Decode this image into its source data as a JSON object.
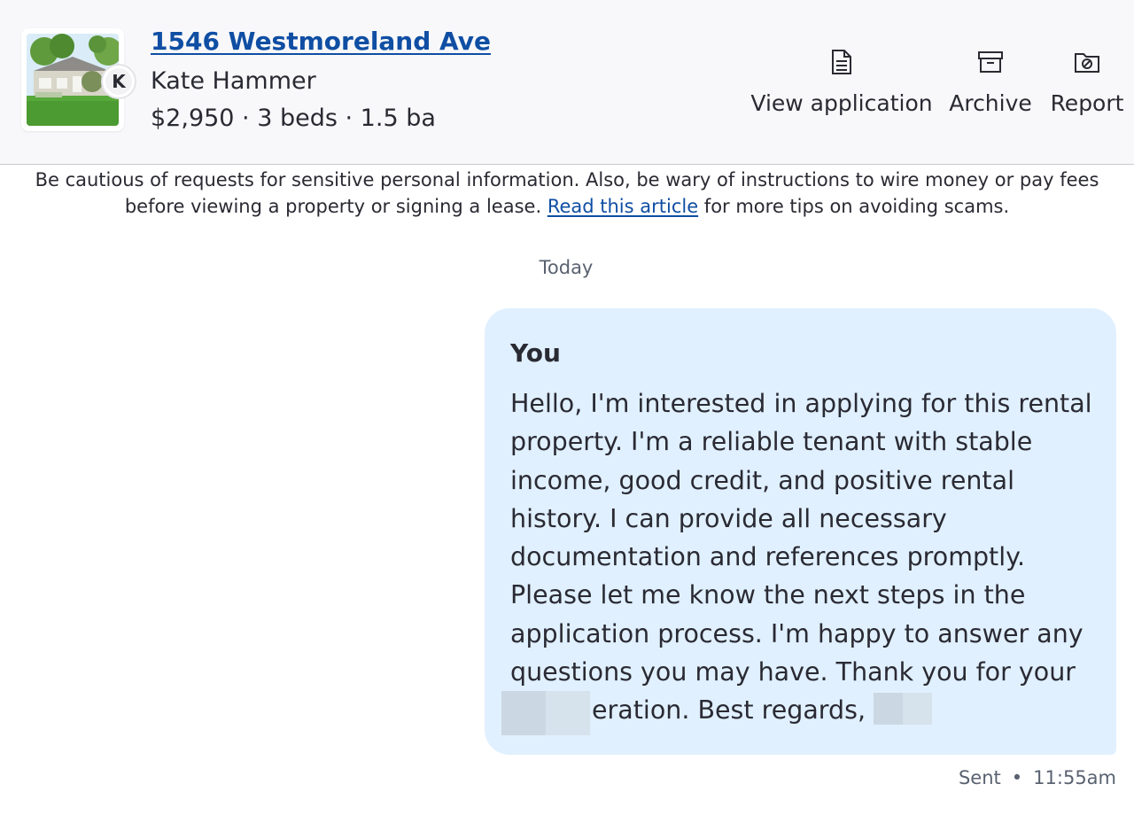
{
  "listing": {
    "address": "1546 Westmoreland Ave",
    "contact_name": "Kate Hammer",
    "avatar_initial": "K",
    "summary": "$2,950 · 3 beds · 1.5 ba",
    "thumbnail": "house-photo"
  },
  "actions": [
    {
      "label": "View application",
      "icon": "document-icon"
    },
    {
      "label": "Archive",
      "icon": "archive-icon"
    },
    {
      "label": "Report",
      "icon": "report-folder-icon"
    }
  ],
  "warning": {
    "text_before": "Be cautious of requests for sensitive personal information. Also, be wary of instructions to wire money or pay fees before viewing a property or signing a lease. ",
    "link_text": "Read this article",
    "text_after": " for more tips on avoiding scams."
  },
  "thread": {
    "date_label": "Today",
    "messages": [
      {
        "sender": "You",
        "body": "Hello, I'm interested in applying for this rental property. I'm a reliable tenant with stable income, good credit, and positive rental history. I can provide all necessary documentation and references promptly. Please let me know the next steps in the application process. I'm happy to answer any questions you may have. Thank you for your consideration. Best regards, ",
        "status": "Sent",
        "separator": "•",
        "time": "11:55am"
      }
    ]
  },
  "colors": {
    "link": "#0f4ea3",
    "bubble": "#e0f0ff",
    "header_bg": "#f8f8fa",
    "muted_text": "#5a6270"
  }
}
